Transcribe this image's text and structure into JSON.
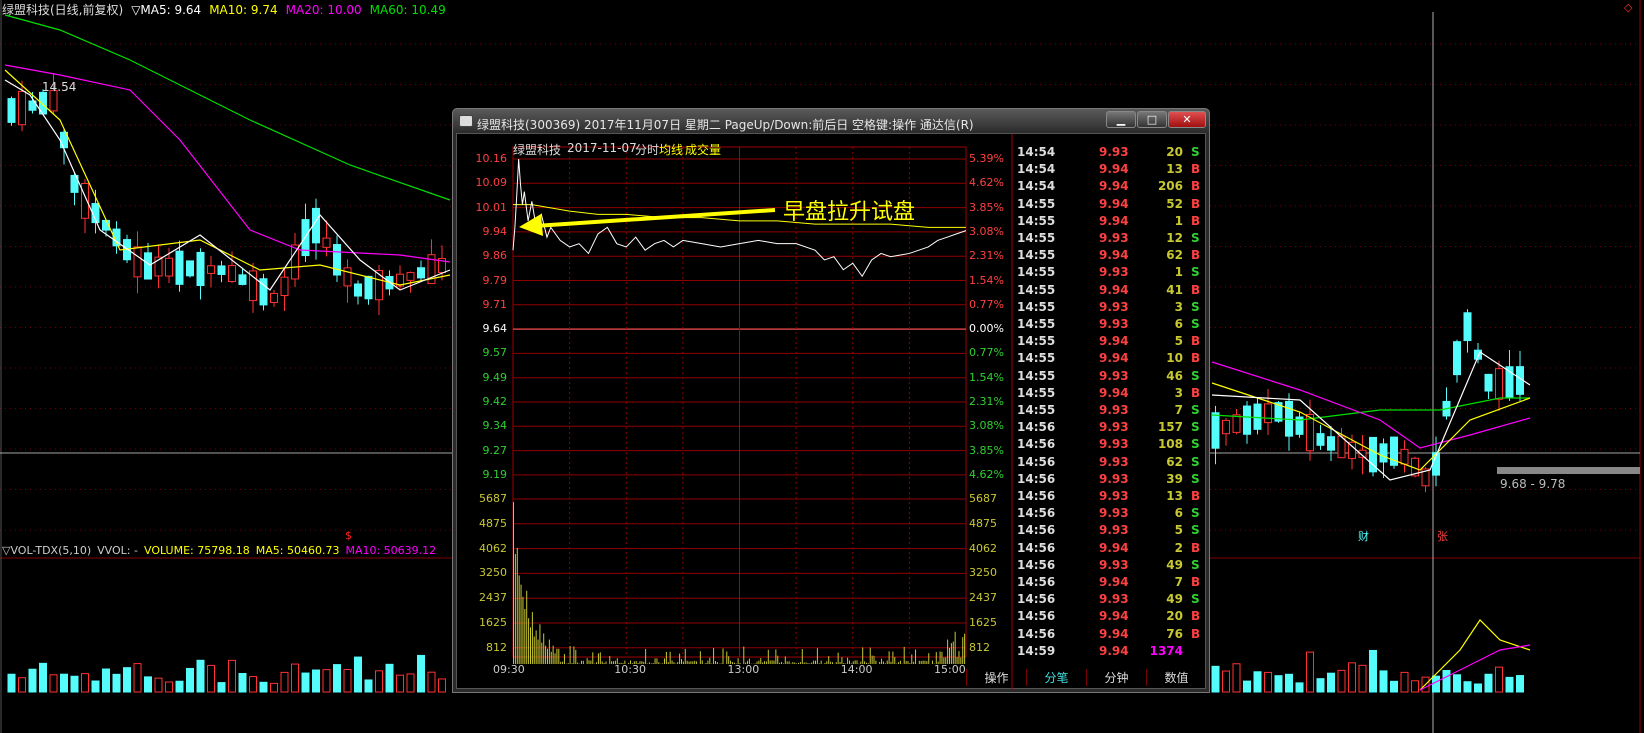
{
  "header": {
    "title": "绿盟科技(日线,前复权)",
    "indicator": "▽MA5: 9.64",
    "ma10": "MA10: 9.74",
    "ma20": "MA20: 10.00",
    "ma60": "MA60: 10.49"
  },
  "colors": {
    "up": "#ff3232",
    "down": "#54fcfc",
    "ma5": "#ffffff",
    "ma10": "#ffff00",
    "ma20": "#ff00ff",
    "ma60": "#00e000",
    "grid": "#800000"
  },
  "main_chart": {
    "high_marker": "14.54",
    "range_label": "9.68 - 9.78",
    "marker_cai": "财",
    "marker_zhang": "张",
    "marker_s": "$"
  },
  "volume_header": {
    "name": "▽VOL-TDX(5,10)",
    "vvol": "VVOL: -",
    "volume": "VOLUME: 75798.18",
    "ma5": "MA5: 50460.73",
    "ma10": "MA10: 50639.12"
  },
  "popup": {
    "title": "绿盟科技(300369) 2017年11月07日 星期二 PageUp/Down:前后日 空格键:操作 通达信(R)",
    "buttons": {
      "minimize": "▁",
      "maximize": "□",
      "close": "✕"
    },
    "chart_header": {
      "name": "绿盟科技",
      "date": "2017-11-07",
      "mode": "分时",
      "avg": "均线",
      "vol": "成交量"
    },
    "annotation": "早盘拉升试盘",
    "price_ticks": [
      "10.16",
      "10.09",
      "10.01",
      "9.94",
      "9.86",
      "9.79",
      "9.71",
      "9.64",
      "9.57",
      "9.49",
      "9.42",
      "9.34",
      "9.27",
      "9.19"
    ],
    "pct_ticks": [
      "5.39%",
      "4.62%",
      "3.85%",
      "3.08%",
      "2.31%",
      "1.54%",
      "0.77%",
      "0.00%",
      "0.77%",
      "1.54%",
      "2.31%",
      "3.08%",
      "3.85%",
      "4.62%"
    ],
    "vol_ticks": [
      "5687",
      "4875",
      "4062",
      "3250",
      "2437",
      "1625",
      "812"
    ],
    "time_ticks": [
      "09:30",
      "10:30",
      "13:00",
      "14:00",
      "15:00"
    ],
    "intraday": {
      "minutes": [
        0,
        1,
        2,
        3,
        4,
        5,
        6,
        8,
        10,
        12,
        15,
        18,
        20,
        25,
        30,
        35,
        40,
        45,
        50,
        55,
        60,
        65,
        70,
        75,
        80,
        85,
        90,
        100,
        110,
        120,
        130,
        140,
        150,
        160,
        165,
        170,
        175,
        180,
        185,
        190,
        195,
        200,
        210,
        220,
        225,
        230,
        235,
        240
      ],
      "price": [
        9.88,
        9.95,
        10.05,
        10.16,
        10.08,
        10.02,
        10.06,
        9.97,
        10.03,
        9.96,
        9.99,
        9.92,
        9.95,
        9.91,
        9.89,
        9.9,
        9.87,
        9.93,
        9.95,
        9.9,
        9.89,
        9.92,
        9.88,
        9.9,
        9.91,
        9.89,
        9.91,
        9.9,
        9.89,
        9.9,
        9.91,
        9.9,
        9.9,
        9.88,
        9.85,
        9.86,
        9.82,
        9.84,
        9.8,
        9.85,
        9.87,
        9.86,
        9.87,
        9.89,
        9.91,
        9.92,
        9.93,
        9.94
      ],
      "avg": [
        10.02,
        10.02,
        10.01,
        10.0,
        9.99,
        9.99,
        9.98,
        9.98,
        9.97,
        9.97,
        9.96,
        9.96,
        9.96,
        9.95,
        9.95
      ],
      "avg_minutes": [
        0,
        10,
        20,
        30,
        45,
        60,
        80,
        100,
        120,
        140,
        160,
        180,
        200,
        220,
        240
      ],
      "early_volume": [
        5300,
        3600,
        3800,
        2900,
        2600,
        2200,
        1800,
        2400,
        1500,
        1200,
        1700,
        900,
        1100,
        800,
        1300,
        700,
        1000,
        600,
        500,
        800,
        400,
        600,
        350,
        500
      ]
    },
    "ticks": [
      {
        "time": "14:54",
        "price": "9.93",
        "vol": "20",
        "side": "S"
      },
      {
        "time": "14:54",
        "price": "9.94",
        "vol": "13",
        "side": "B"
      },
      {
        "time": "14:54",
        "price": "9.94",
        "vol": "206",
        "side": "B"
      },
      {
        "time": "14:55",
        "price": "9.94",
        "vol": "52",
        "side": "B"
      },
      {
        "time": "14:55",
        "price": "9.94",
        "vol": "1",
        "side": "B"
      },
      {
        "time": "14:55",
        "price": "9.93",
        "vol": "12",
        "side": "S"
      },
      {
        "time": "14:55",
        "price": "9.94",
        "vol": "62",
        "side": "B"
      },
      {
        "time": "14:55",
        "price": "9.93",
        "vol": "1",
        "side": "S"
      },
      {
        "time": "14:55",
        "price": "9.94",
        "vol": "41",
        "side": "B"
      },
      {
        "time": "14:55",
        "price": "9.93",
        "vol": "3",
        "side": "S"
      },
      {
        "time": "14:55",
        "price": "9.93",
        "vol": "6",
        "side": "S"
      },
      {
        "time": "14:55",
        "price": "9.94",
        "vol": "5",
        "side": "B"
      },
      {
        "time": "14:55",
        "price": "9.94",
        "vol": "10",
        "side": "B"
      },
      {
        "time": "14:55",
        "price": "9.93",
        "vol": "46",
        "side": "S"
      },
      {
        "time": "14:55",
        "price": "9.94",
        "vol": "3",
        "side": "B"
      },
      {
        "time": "14:55",
        "price": "9.93",
        "vol": "7",
        "side": "S"
      },
      {
        "time": "14:56",
        "price": "9.93",
        "vol": "157",
        "side": "S"
      },
      {
        "time": "14:56",
        "price": "9.93",
        "vol": "108",
        "side": "S"
      },
      {
        "time": "14:56",
        "price": "9.93",
        "vol": "62",
        "side": "S"
      },
      {
        "time": "14:56",
        "price": "9.93",
        "vol": "39",
        "side": "S"
      },
      {
        "time": "14:56",
        "price": "9.93",
        "vol": "13",
        "side": "B"
      },
      {
        "time": "14:56",
        "price": "9.93",
        "vol": "6",
        "side": "S"
      },
      {
        "time": "14:56",
        "price": "9.93",
        "vol": "5",
        "side": "S"
      },
      {
        "time": "14:56",
        "price": "9.94",
        "vol": "2",
        "side": "B"
      },
      {
        "time": "14:56",
        "price": "9.93",
        "vol": "49",
        "side": "S"
      },
      {
        "time": "14:56",
        "price": "9.94",
        "vol": "7",
        "side": "B"
      },
      {
        "time": "14:56",
        "price": "9.93",
        "vol": "49",
        "side": "S"
      },
      {
        "time": "14:56",
        "price": "9.94",
        "vol": "20",
        "side": "B"
      },
      {
        "time": "14:56",
        "price": "9.94",
        "vol": "76",
        "side": "B"
      },
      {
        "time": "14:59",
        "price": "9.94",
        "vol": "1374",
        "side": ""
      }
    ],
    "tabs": [
      "操作",
      "分笔",
      "分钟",
      "数值"
    ],
    "active_tab": "分笔"
  }
}
